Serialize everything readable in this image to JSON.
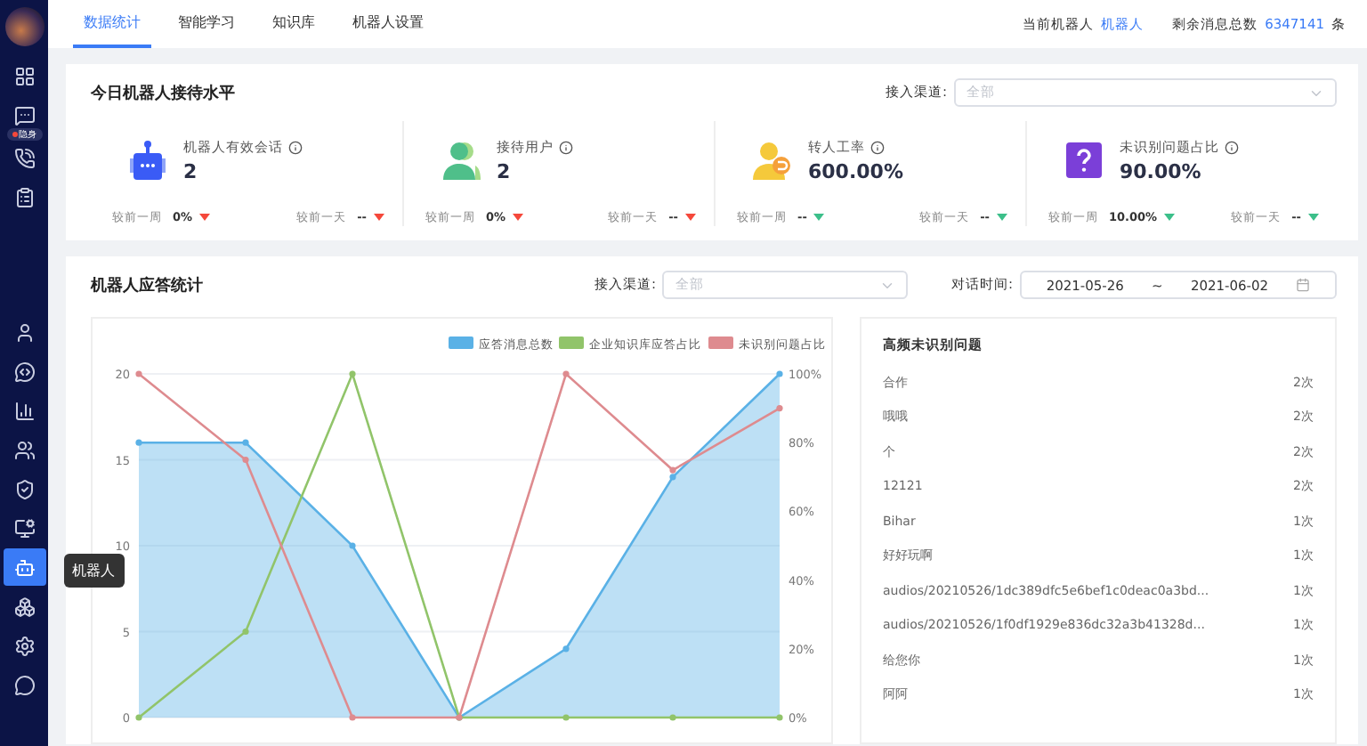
{
  "sidebar": {
    "badge": "隐身",
    "tooltip": "机器人",
    "items": [
      {
        "selected": false
      },
      {
        "selected": false
      },
      {
        "selected": false
      },
      {
        "selected": false
      },
      {
        "selected": false
      },
      {
        "selected": false
      },
      {
        "selected": false
      },
      {
        "selected": false
      },
      {
        "selected": false
      },
      {
        "selected": false
      },
      {
        "selected": true
      },
      {
        "selected": false
      },
      {
        "selected": false
      },
      {
        "selected": false
      }
    ]
  },
  "tabs": [
    {
      "label": "数据统计",
      "selected": true
    },
    {
      "label": "智能学习",
      "selected": false
    },
    {
      "label": "知识库",
      "selected": false
    },
    {
      "label": "机器人设置",
      "selected": false
    }
  ],
  "header": {
    "robot_label": "当前机器人",
    "robot_name": "机器人",
    "remaining_label": "剩余消息总数",
    "remaining_count": "6347141",
    "remaining_unit": "条"
  },
  "reception": {
    "title": "今日机器人接待水平",
    "channel_label": "接入渠道:",
    "channel_placeholder": "全部",
    "stats": [
      {
        "kind": "bot",
        "label": "机器人有效会话",
        "value": "2",
        "comparisons": [
          {
            "label": "较前一周",
            "value": "0%",
            "color": "#f5483b"
          },
          {
            "label": "较前一天",
            "value": "--",
            "color": "#f5483b"
          }
        ]
      },
      {
        "kind": "users",
        "label": "接待用户",
        "value": "2",
        "comparisons": [
          {
            "label": "较前一周",
            "value": "0%",
            "color": "#f5483b"
          },
          {
            "label": "较前一天",
            "value": "--",
            "color": "#f5483b"
          }
        ]
      },
      {
        "kind": "transfer",
        "label": "转人工率",
        "value": "600.00%",
        "comparisons": [
          {
            "label": "较前一周",
            "value": "--",
            "color": "#3cbf8a"
          },
          {
            "label": "较前一天",
            "value": "--",
            "color": "#3cbf8a"
          }
        ]
      },
      {
        "kind": "question",
        "label": "未识别问题占比",
        "value": "90.00%",
        "comparisons": [
          {
            "label": "较前一周",
            "value": "10.00%",
            "color": "#3cbf8a"
          },
          {
            "label": "较前一天",
            "value": "--",
            "color": "#3cbf8a"
          }
        ]
      }
    ]
  },
  "responses": {
    "title": "机器人应答统计",
    "channel_label": "接入渠道:",
    "channel_placeholder": "全部",
    "date_label": "对话时间:",
    "date_from": "2021-05-26",
    "date_separator": "~",
    "date_to": "2021-06-02",
    "chart_data": {
      "type": "line",
      "grid": true,
      "legend": "top-right",
      "ylim": [
        0,
        20
      ],
      "yticks": [
        0,
        5,
        10,
        15,
        20
      ],
      "y2lim": [
        0,
        100
      ],
      "y2ticks": [
        {
          "value": 0,
          "label": "0%"
        },
        {
          "value": 20,
          "label": "20%"
        },
        {
          "value": 40,
          "label": "40%"
        },
        {
          "value": 60,
          "label": "60%"
        },
        {
          "value": 80,
          "label": "80%"
        },
        {
          "value": 100,
          "label": "100%"
        }
      ],
      "series": [
        {
          "name": "应答消息总数",
          "color": "#5ab1e6",
          "marker": true,
          "values": [
            16,
            16,
            10,
            0,
            4,
            14,
            20
          ]
        },
        {
          "name": "企业知识库应答占比",
          "color": "#91c46a",
          "axis": "y2",
          "marker": true,
          "values": [
            0,
            25,
            100,
            0,
            0,
            0,
            0
          ]
        },
        {
          "name": "未识别问题占比",
          "color": "#de8b8f",
          "axis": "y2",
          "marker": true,
          "values": [
            100,
            75,
            0,
            0,
            100,
            72,
            90
          ]
        }
      ]
    },
    "top_unrecognized": {
      "title": "高频未识别问题",
      "rows": [
        {
          "question": "合作",
          "count": "2次"
        },
        {
          "question": "哦哦",
          "count": "2次"
        },
        {
          "question": "个",
          "count": "2次"
        },
        {
          "question": "12121",
          "count": "2次"
        },
        {
          "question": "Bihar",
          "count": "1次"
        },
        {
          "question": "好好玩啊",
          "count": "1次"
        },
        {
          "question": "audios/20210526/1dc389dfc5e6bef1c0deac0a3bd...",
          "count": "1次"
        },
        {
          "question": "audios/20210526/1f0df1929e836dc32a3b41328d...",
          "count": "1次"
        },
        {
          "question": "给您你",
          "count": "1次"
        },
        {
          "question": "阿阿",
          "count": "1次"
        }
      ]
    }
  }
}
